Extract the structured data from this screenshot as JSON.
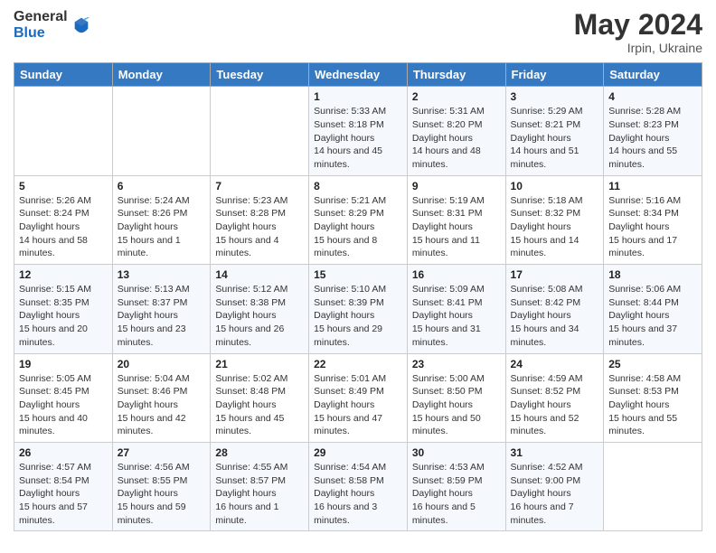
{
  "header": {
    "logo_general": "General",
    "logo_blue": "Blue",
    "month_year": "May 2024",
    "location": "Irpin, Ukraine"
  },
  "weekdays": [
    "Sunday",
    "Monday",
    "Tuesday",
    "Wednesday",
    "Thursday",
    "Friday",
    "Saturday"
  ],
  "weeks": [
    [
      null,
      null,
      null,
      {
        "day": "1",
        "sunrise": "5:33 AM",
        "sunset": "8:18 PM",
        "daylight": "14 hours and 45 minutes."
      },
      {
        "day": "2",
        "sunrise": "5:31 AM",
        "sunset": "8:20 PM",
        "daylight": "14 hours and 48 minutes."
      },
      {
        "day": "3",
        "sunrise": "5:29 AM",
        "sunset": "8:21 PM",
        "daylight": "14 hours and 51 minutes."
      },
      {
        "day": "4",
        "sunrise": "5:28 AM",
        "sunset": "8:23 PM",
        "daylight": "14 hours and 55 minutes."
      }
    ],
    [
      {
        "day": "5",
        "sunrise": "5:26 AM",
        "sunset": "8:24 PM",
        "daylight": "14 hours and 58 minutes."
      },
      {
        "day": "6",
        "sunrise": "5:24 AM",
        "sunset": "8:26 PM",
        "daylight": "15 hours and 1 minute."
      },
      {
        "day": "7",
        "sunrise": "5:23 AM",
        "sunset": "8:28 PM",
        "daylight": "15 hours and 4 minutes."
      },
      {
        "day": "8",
        "sunrise": "5:21 AM",
        "sunset": "8:29 PM",
        "daylight": "15 hours and 8 minutes."
      },
      {
        "day": "9",
        "sunrise": "5:19 AM",
        "sunset": "8:31 PM",
        "daylight": "15 hours and 11 minutes."
      },
      {
        "day": "10",
        "sunrise": "5:18 AM",
        "sunset": "8:32 PM",
        "daylight": "15 hours and 14 minutes."
      },
      {
        "day": "11",
        "sunrise": "5:16 AM",
        "sunset": "8:34 PM",
        "daylight": "15 hours and 17 minutes."
      }
    ],
    [
      {
        "day": "12",
        "sunrise": "5:15 AM",
        "sunset": "8:35 PM",
        "daylight": "15 hours and 20 minutes."
      },
      {
        "day": "13",
        "sunrise": "5:13 AM",
        "sunset": "8:37 PM",
        "daylight": "15 hours and 23 minutes."
      },
      {
        "day": "14",
        "sunrise": "5:12 AM",
        "sunset": "8:38 PM",
        "daylight": "15 hours and 26 minutes."
      },
      {
        "day": "15",
        "sunrise": "5:10 AM",
        "sunset": "8:39 PM",
        "daylight": "15 hours and 29 minutes."
      },
      {
        "day": "16",
        "sunrise": "5:09 AM",
        "sunset": "8:41 PM",
        "daylight": "15 hours and 31 minutes."
      },
      {
        "day": "17",
        "sunrise": "5:08 AM",
        "sunset": "8:42 PM",
        "daylight": "15 hours and 34 minutes."
      },
      {
        "day": "18",
        "sunrise": "5:06 AM",
        "sunset": "8:44 PM",
        "daylight": "15 hours and 37 minutes."
      }
    ],
    [
      {
        "day": "19",
        "sunrise": "5:05 AM",
        "sunset": "8:45 PM",
        "daylight": "15 hours and 40 minutes."
      },
      {
        "day": "20",
        "sunrise": "5:04 AM",
        "sunset": "8:46 PM",
        "daylight": "15 hours and 42 minutes."
      },
      {
        "day": "21",
        "sunrise": "5:02 AM",
        "sunset": "8:48 PM",
        "daylight": "15 hours and 45 minutes."
      },
      {
        "day": "22",
        "sunrise": "5:01 AM",
        "sunset": "8:49 PM",
        "daylight": "15 hours and 47 minutes."
      },
      {
        "day": "23",
        "sunrise": "5:00 AM",
        "sunset": "8:50 PM",
        "daylight": "15 hours and 50 minutes."
      },
      {
        "day": "24",
        "sunrise": "4:59 AM",
        "sunset": "8:52 PM",
        "daylight": "15 hours and 52 minutes."
      },
      {
        "day": "25",
        "sunrise": "4:58 AM",
        "sunset": "8:53 PM",
        "daylight": "15 hours and 55 minutes."
      }
    ],
    [
      {
        "day": "26",
        "sunrise": "4:57 AM",
        "sunset": "8:54 PM",
        "daylight": "15 hours and 57 minutes."
      },
      {
        "day": "27",
        "sunrise": "4:56 AM",
        "sunset": "8:55 PM",
        "daylight": "15 hours and 59 minutes."
      },
      {
        "day": "28",
        "sunrise": "4:55 AM",
        "sunset": "8:57 PM",
        "daylight": "16 hours and 1 minute."
      },
      {
        "day": "29",
        "sunrise": "4:54 AM",
        "sunset": "8:58 PM",
        "daylight": "16 hours and 3 minutes."
      },
      {
        "day": "30",
        "sunrise": "4:53 AM",
        "sunset": "8:59 PM",
        "daylight": "16 hours and 5 minutes."
      },
      {
        "day": "31",
        "sunrise": "4:52 AM",
        "sunset": "9:00 PM",
        "daylight": "16 hours and 7 minutes."
      },
      null
    ]
  ],
  "labels": {
    "sunrise": "Sunrise:",
    "sunset": "Sunset:",
    "daylight": "Daylight hours"
  }
}
